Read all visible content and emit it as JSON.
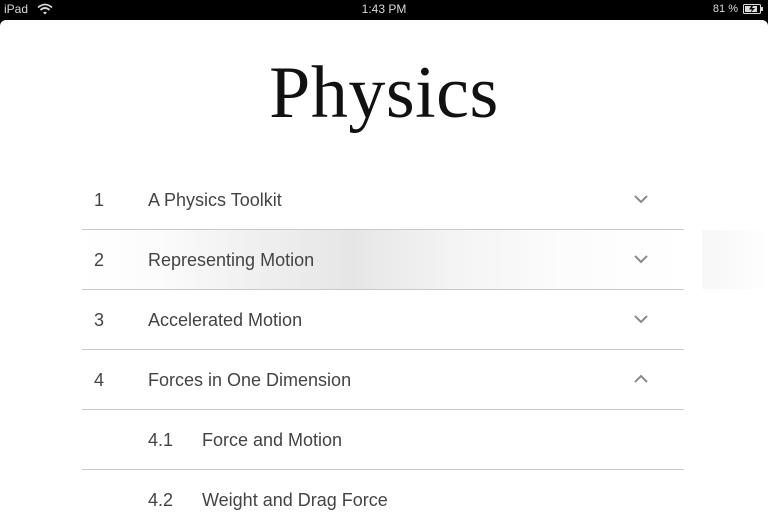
{
  "status_bar": {
    "device": "iPad",
    "time": "1:43 PM",
    "battery": "81 %"
  },
  "book": {
    "title": "Physics"
  },
  "toc": {
    "rows": [
      {
        "number": "1",
        "title": "A Physics Toolkit",
        "chevron": "chevron-down-icon"
      },
      {
        "number": "2",
        "title": "Representing Motion",
        "chevron": "chevron-down-icon"
      },
      {
        "number": "3",
        "title": "Accelerated Motion",
        "chevron": "chevron-down-icon"
      },
      {
        "number": "4",
        "title": "Forces in One Dimension",
        "chevron": "chevron-up-icon"
      }
    ],
    "subrows": [
      {
        "number": "4.1",
        "title": "Force and Motion"
      },
      {
        "number": "4.2",
        "title": "Weight and Drag Force"
      }
    ]
  },
  "colors": {
    "text": "#444444",
    "divider": "#c9c9c9",
    "chevron": "#8a8a8a"
  }
}
